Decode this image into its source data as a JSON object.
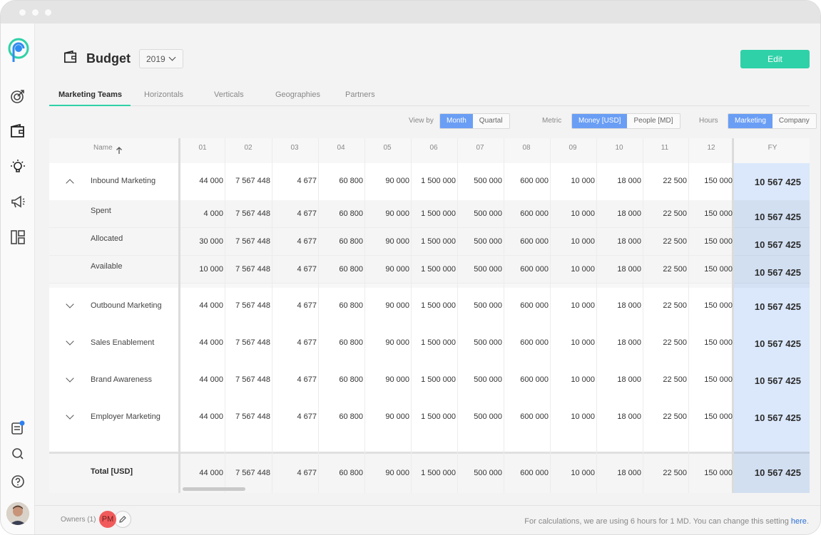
{
  "page": {
    "title": "Budget",
    "year": "2019",
    "edit_label": "Edit"
  },
  "tabs": [
    {
      "label": "Marketing Teams",
      "active": true
    },
    {
      "label": "Horizontals",
      "active": false
    },
    {
      "label": "Verticals",
      "active": false
    },
    {
      "label": "Geographies",
      "active": false
    },
    {
      "label": "Partners",
      "active": false
    }
  ],
  "toggles": {
    "view_by": {
      "label": "View by",
      "options": [
        "Month",
        "Quartal"
      ],
      "selected": "Month"
    },
    "metric": {
      "label": "Metric",
      "options": [
        "Money [USD]",
        "People [MD]"
      ],
      "selected": "Money [USD]"
    },
    "hours": {
      "label": "Hours",
      "options": [
        "Marketing",
        "Company"
      ],
      "selected": "Marketing"
    }
  },
  "table": {
    "name_header": "Name",
    "month_headers": [
      "01",
      "02",
      "03",
      "04",
      "05",
      "06",
      "07",
      "08",
      "09",
      "10",
      "11",
      "12"
    ],
    "fy_header": "FY",
    "rows": [
      {
        "name": "Inbound Marketing",
        "expanded": true,
        "values": [
          "44 000",
          "7 567 448",
          "4 677",
          "60 800",
          "90 000",
          "1 500 000",
          "500 000",
          "600 000",
          "10 000",
          "18 000",
          "22 500",
          "150 000"
        ],
        "fy": "10 567 425",
        "children": [
          {
            "name": "Spent",
            "values": [
              "4 000",
              "7 567 448",
              "4 677",
              "60 800",
              "90 000",
              "1 500 000",
              "500 000",
              "600 000",
              "10 000",
              "18 000",
              "22 500",
              "150 000"
            ],
            "fy": "10 567 425"
          },
          {
            "name": "Allocated",
            "values": [
              "30 000",
              "7 567 448",
              "4 677",
              "60 800",
              "90 000",
              "1 500 000",
              "500 000",
              "600 000",
              "10 000",
              "18 000",
              "22 500",
              "150 000"
            ],
            "fy": "10 567 425"
          },
          {
            "name": "Available",
            "values": [
              "10 000",
              "7 567 448",
              "4 677",
              "60 800",
              "90 000",
              "1 500 000",
              "500 000",
              "600 000",
              "10 000",
              "18 000",
              "22 500",
              "150 000"
            ],
            "fy": "10 567 425"
          }
        ]
      },
      {
        "name": "Outbound Marketing",
        "expanded": false,
        "values": [
          "44 000",
          "7 567 448",
          "4 677",
          "60 800",
          "90 000",
          "1 500 000",
          "500 000",
          "600 000",
          "10 000",
          "18 000",
          "22 500",
          "150 000"
        ],
        "fy": "10 567 425"
      },
      {
        "name": "Sales Enablement",
        "expanded": false,
        "values": [
          "44 000",
          "7 567 448",
          "4 677",
          "60 800",
          "90 000",
          "1 500 000",
          "500 000",
          "600 000",
          "10 000",
          "18 000",
          "22 500",
          "150 000"
        ],
        "fy": "10 567 425"
      },
      {
        "name": "Brand Awareness",
        "expanded": false,
        "values": [
          "44 000",
          "7 567 448",
          "4 677",
          "60 800",
          "90 000",
          "1 500 000",
          "500 000",
          "600 000",
          "10 000",
          "18 000",
          "22 500",
          "150 000"
        ],
        "fy": "10 567 425"
      },
      {
        "name": "Employer Marketing",
        "expanded": false,
        "values": [
          "44 000",
          "7 567 448",
          "4 677",
          "60 800",
          "90 000",
          "1 500 000",
          "500 000",
          "600 000",
          "10 000",
          "18 000",
          "22 500",
          "150 000"
        ],
        "fy": "10 567 425"
      }
    ],
    "total": {
      "name": "Total [USD]",
      "values": [
        "44 000",
        "7 567 448",
        "4 677",
        "60 800",
        "90 000",
        "1 500 000",
        "500 000",
        "600 000",
        "10 000",
        "18 000",
        "22 500",
        "150 000"
      ],
      "fy": "10 567 425"
    }
  },
  "footer": {
    "owners_label": "Owners (1)",
    "owner_initials": "PM",
    "note": "For calculations, we are using 6 hours for 1 MD. You can change this setting ",
    "note_link": "here",
    "note_end": "."
  },
  "colors": {
    "accent": "#2fd1a8",
    "toggle_on": "#6a9ef5",
    "fy_bg": "#dbe8fb",
    "owner_avatar": "#f15b5b"
  }
}
